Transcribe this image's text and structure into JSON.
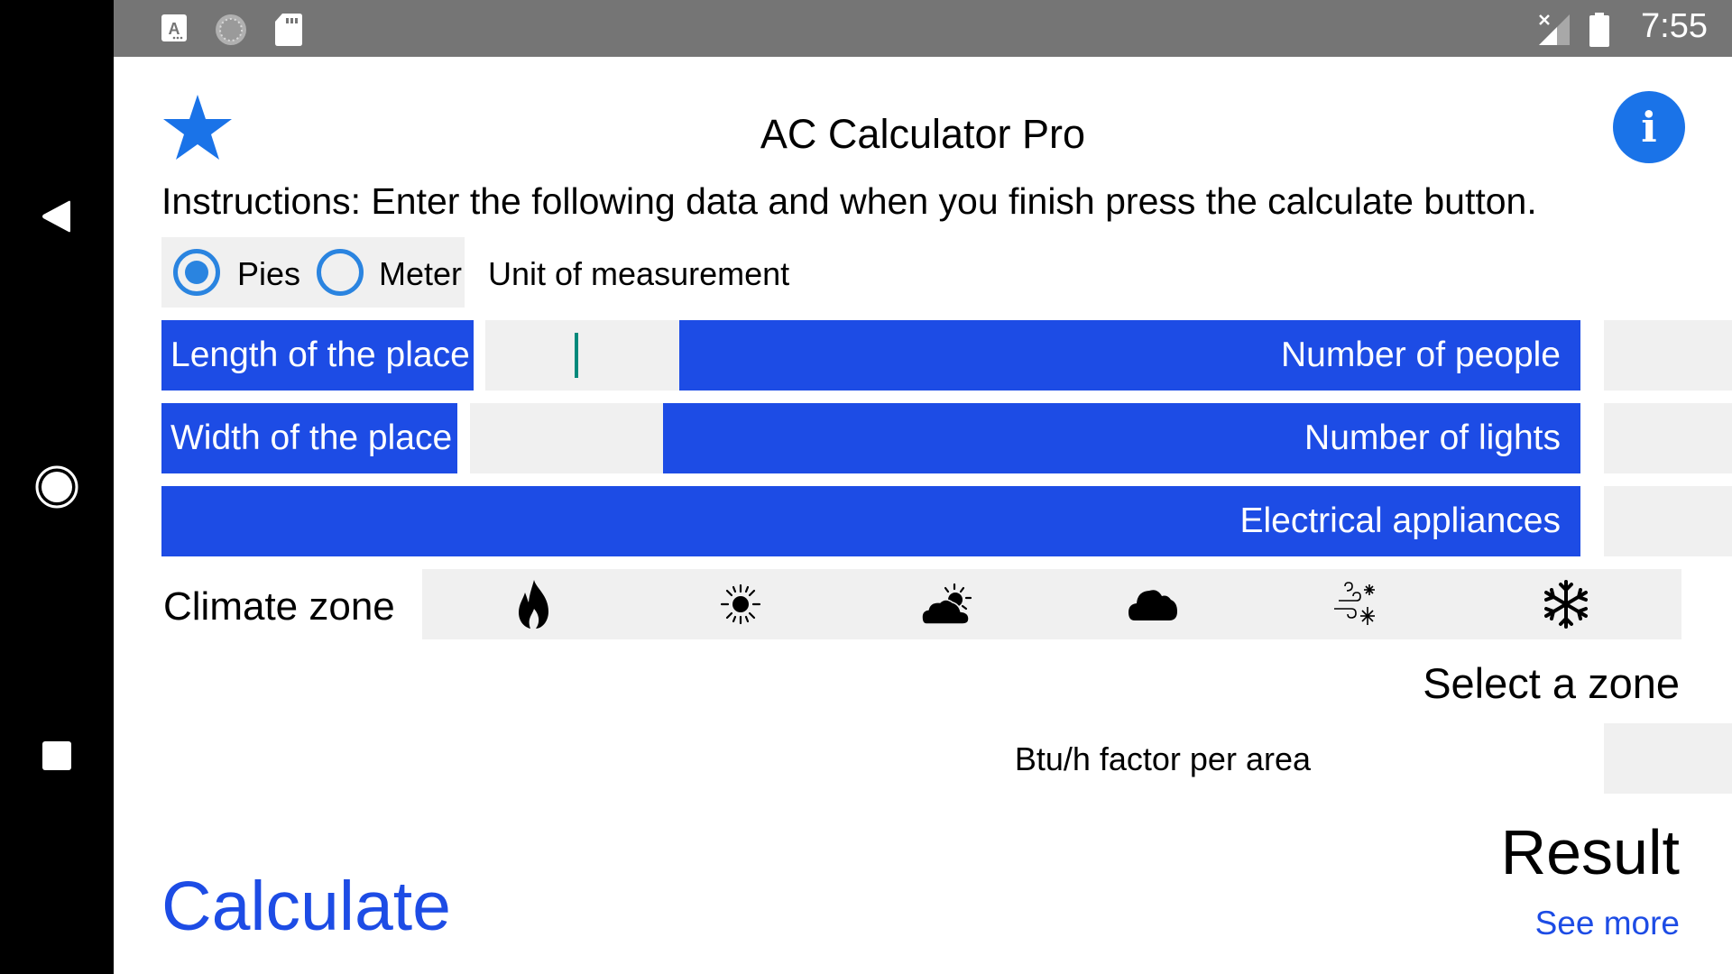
{
  "status_bar": {
    "time": "7:55",
    "icons": [
      "text-a-icon",
      "sync-loading-icon",
      "sd-card-icon",
      "no-signal-icon",
      "battery-icon"
    ]
  },
  "nav_bar": {
    "back": "back-icon",
    "home": "home-icon",
    "recents": "recents-icon"
  },
  "header": {
    "title": "AC Calculator Pro",
    "favorite_icon": "star-icon",
    "info_icon": "info-icon",
    "info_glyph": "i"
  },
  "instructions": "Instructions: Enter the following data and when you finish press the calculate button.",
  "unit": {
    "options": [
      {
        "label": "Pies",
        "selected": true
      },
      {
        "label": "Meter",
        "selected": false
      }
    ],
    "label": "Unit of measurement"
  },
  "fields": {
    "length": {
      "label": "Length of the place",
      "value": ""
    },
    "width": {
      "label": "Width of the place",
      "value": ""
    },
    "people": {
      "label": "Number of people",
      "value": ""
    },
    "lights": {
      "label": "Number of lights",
      "value": ""
    },
    "appliances": {
      "label": "Electrical appliances",
      "value": ""
    }
  },
  "climate": {
    "label": "Climate zone",
    "zones": [
      {
        "name": "very-hot",
        "icon": "fire-icon"
      },
      {
        "name": "hot",
        "icon": "sun-icon"
      },
      {
        "name": "partly-cloudy",
        "icon": "cloud-sun-icon"
      },
      {
        "name": "cloudy",
        "icon": "cloud-icon"
      },
      {
        "name": "windy-cold",
        "icon": "wind-snow-icon"
      },
      {
        "name": "very-cold",
        "icon": "snowflake-icon"
      }
    ],
    "selection_text": "Select a zone"
  },
  "btu": {
    "label": "Btu/h factor per area",
    "value": ""
  },
  "result": {
    "label": "Result",
    "see_more": "See more"
  },
  "actions": {
    "calculate": "Calculate"
  },
  "colors": {
    "primary_blue": "#1d4ce5",
    "accent_blue": "#1a73e8",
    "radio_blue": "#2a84e0",
    "field_gray": "#f0f0f0",
    "cursor_teal": "#00897b"
  }
}
